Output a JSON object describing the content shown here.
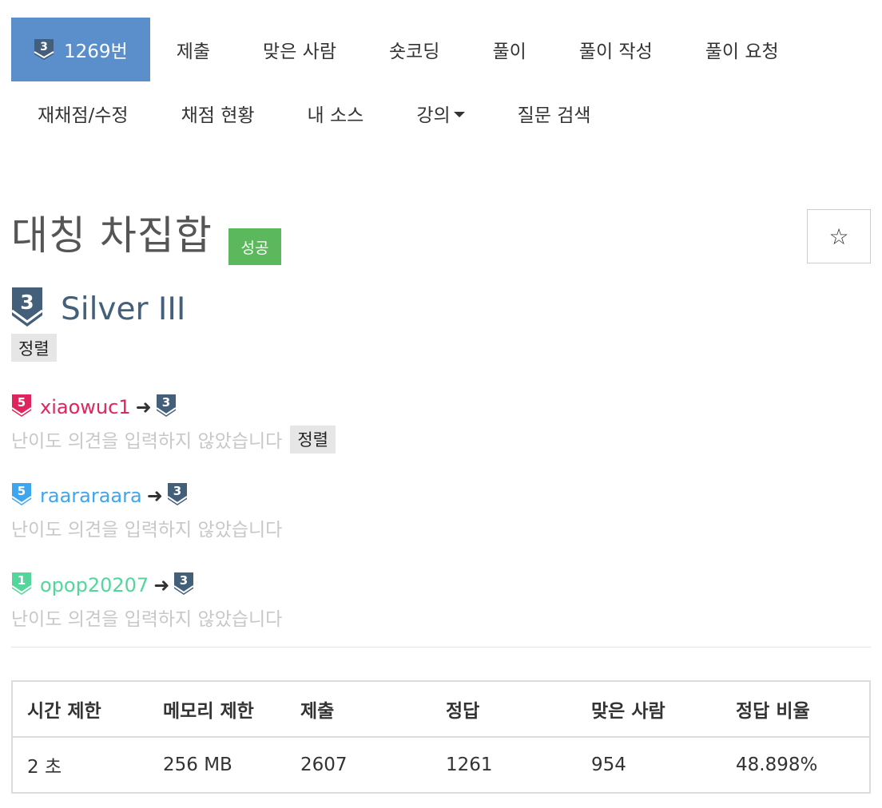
{
  "nav": {
    "row1": [
      {
        "label": "1269번",
        "active": true,
        "tier": "3"
      },
      {
        "label": "제출"
      },
      {
        "label": "맞은 사람"
      },
      {
        "label": "숏코딩"
      },
      {
        "label": "풀이"
      },
      {
        "label": "풀이 작성"
      },
      {
        "label": "풀이 요청"
      }
    ],
    "row2": [
      {
        "label": "재채점/수정"
      },
      {
        "label": "채점 현황"
      },
      {
        "label": "내 소스"
      },
      {
        "label": "강의"
      },
      {
        "label": "질문 검색"
      }
    ]
  },
  "problem": {
    "title": "대칭 차집합",
    "status": "성공",
    "star": "☆",
    "tier_number": "3",
    "tier_label": "Silver III",
    "tag": "정렬"
  },
  "opinions": [
    {
      "tier_number": "5",
      "user": "xiaowuc1",
      "user_color": "#e0245e",
      "arrow": "➜",
      "to_tier": "3",
      "text": "난이도 의견을 입력하지 않았습니다",
      "tag": "정렬"
    },
    {
      "tier_number": "5",
      "user": "raararaara",
      "user_color": "#3ea6ee",
      "arrow": "➜",
      "to_tier": "3",
      "text": "난이도 의견을 입력하지 않았습니다"
    },
    {
      "tier_number": "1",
      "user": "opop20207",
      "user_color": "#52d69c",
      "arrow": "➜",
      "to_tier": "3",
      "text": "난이도 의견을 입력하지 않았습니다"
    }
  ],
  "table": {
    "headers": [
      "시간 제한",
      "메모리 제한",
      "제출",
      "정답",
      "맞은 사람",
      "정답 비율"
    ],
    "row": [
      "2 초",
      "256 MB",
      "2607",
      "1261",
      "954",
      "48.898%"
    ]
  },
  "colors": {
    "silver": "#435f7a",
    "ruby": "#e0245e",
    "diamond": "#3ea6ee",
    "platinum": "#52d69c",
    "active_nav": "#5a8fcb",
    "success": "#5cb85c"
  }
}
